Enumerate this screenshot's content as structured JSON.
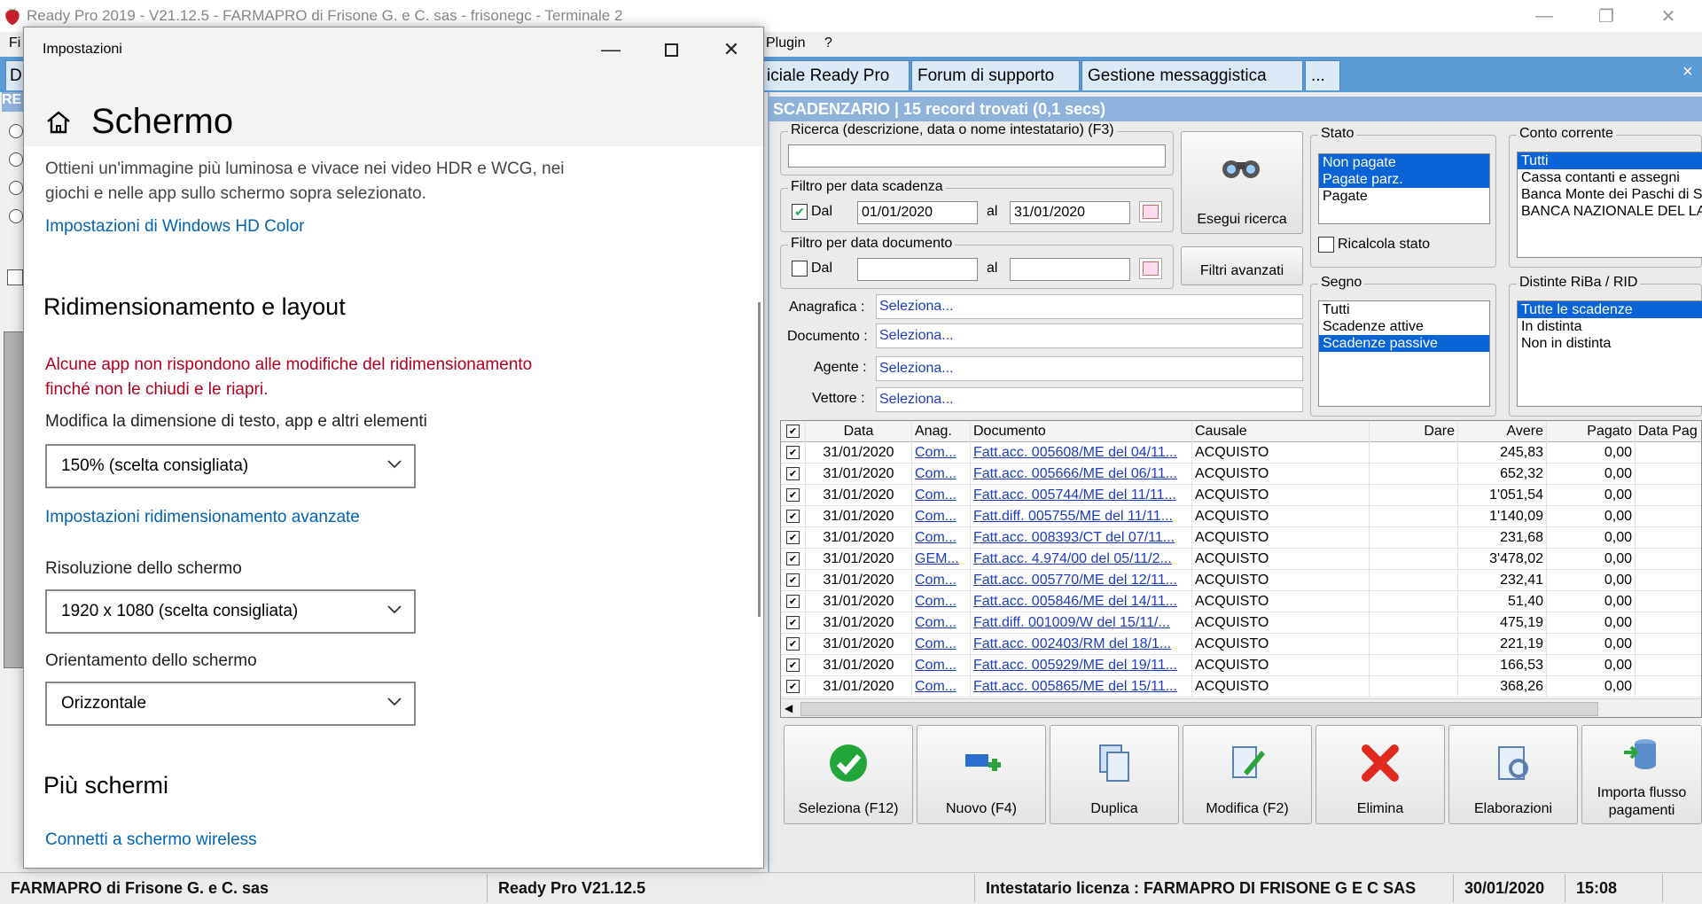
{
  "window": {
    "title": "Ready Pro 2019 - V21.12.5 - FARMAPRO di Frisone G. e C. sas - frisonegc - Terminale 2",
    "min": "—",
    "restore": "❐",
    "close": "✕"
  },
  "menu": {
    "file_partial": "Fi",
    "plugin": "Plugin",
    "help": "?"
  },
  "tabs": [
    "iciale Ready Pro",
    "Forum di supporto",
    "Gestione messaggistica",
    "..."
  ],
  "tab_close": "×",
  "left_sliver": {
    "tab_partial": "D",
    "label_partial": "RE"
  },
  "scadenzario": {
    "header": "SCADENZARIO | 15 record trovati (0,1 secs)",
    "search_label": "Ricerca (descrizione, data o nome intestatario) (F3)",
    "search_value": "",
    "filter_due_label": "Filtro per data scadenza",
    "due_dal_checked": true,
    "dal_label": "Dal",
    "al_label": "al",
    "due_from": "01/01/2020",
    "due_to": "31/01/2020",
    "filter_doc_label": "Filtro per data documento",
    "doc_dal_checked": false,
    "doc_from": "",
    "doc_to": "",
    "search_button": "Esegui ricerca",
    "advanced_button": "Filtri avanzati",
    "anagrafica_label": "Anagrafica :",
    "documento_label": "Documento :",
    "agente_label": "Agente :",
    "vettore_label": "Vettore :",
    "select_placeholder": "Seleziona...",
    "stato": {
      "title": "Stato",
      "items": [
        "Non pagate",
        "Pagate parz.",
        "Pagate"
      ],
      "selected": [
        0,
        1
      ]
    },
    "ricalcola_label": "Ricalcola stato",
    "segno": {
      "title": "Segno",
      "items": [
        "Tutti",
        "Scadenze attive",
        "Scadenze passive"
      ],
      "selected": [
        2
      ]
    },
    "conto": {
      "title": "Conto corrente",
      "items": [
        "Tutti",
        "Cassa contanti e assegni",
        "Banca Monte dei Paschi di Si",
        "BANCA NAZIONALE DEL LAV"
      ],
      "selected": [
        0
      ]
    },
    "distinte": {
      "title": "Distinte RiBa / RID",
      "items": [
        "Tutte le scadenze",
        "In distinta",
        "Non in distinta"
      ],
      "selected": [
        0
      ]
    },
    "columns": [
      "Data",
      "Anag.",
      "Documento",
      "Causale",
      "Dare",
      "Avere",
      "Pagato",
      "Data Pag"
    ],
    "rows": [
      [
        "31/01/2020",
        "Com...",
        "Fatt.acc. 005608/ME del 04/11...",
        "ACQUISTO",
        "",
        "245,83",
        "0,00"
      ],
      [
        "31/01/2020",
        "Com...",
        "Fatt.acc. 005666/ME del 06/11...",
        "ACQUISTO",
        "",
        "652,32",
        "0,00"
      ],
      [
        "31/01/2020",
        "Com...",
        "Fatt.acc. 005744/ME del 11/11...",
        "ACQUISTO",
        "",
        "1'051,54",
        "0,00"
      ],
      [
        "31/01/2020",
        "Com...",
        "Fatt.diff. 005755/ME del 11/11...",
        "ACQUISTO",
        "",
        "1'140,09",
        "0,00"
      ],
      [
        "31/01/2020",
        "Com...",
        "Fatt.acc. 008393/CT del 07/11...",
        "ACQUISTO",
        "",
        "231,68",
        "0,00"
      ],
      [
        "31/01/2020",
        "GEM...",
        "Fatt.acc. 4.974/00 del 05/11/2...",
        "ACQUISTO",
        "",
        "3'478,02",
        "0,00"
      ],
      [
        "31/01/2020",
        "Com...",
        "Fatt.acc. 005770/ME del 12/11...",
        "ACQUISTO",
        "",
        "232,41",
        "0,00"
      ],
      [
        "31/01/2020",
        "Com...",
        "Fatt.acc. 005846/ME del 14/11...",
        "ACQUISTO",
        "",
        "51,40",
        "0,00"
      ],
      [
        "31/01/2020",
        "Com...",
        "Fatt.diff. 001009/W del 15/11/...",
        "ACQUISTO",
        "",
        "475,19",
        "0,00"
      ],
      [
        "31/01/2020",
        "Com...",
        "Fatt.acc. 002403/RM del 18/1...",
        "ACQUISTO",
        "",
        "221,19",
        "0,00"
      ],
      [
        "31/01/2020",
        "Com...",
        "Fatt.acc. 005929/ME del 19/11...",
        "ACQUISTO",
        "",
        "166,53",
        "0,00"
      ],
      [
        "31/01/2020",
        "Com...",
        "Fatt.acc. 005865/ME del 15/11...",
        "ACQUISTO",
        "",
        "368,26",
        "0,00"
      ]
    ],
    "actions": [
      {
        "label": "Seleziona (F12)",
        "icon": "checkmark-icon"
      },
      {
        "label": "Nuovo (F4)",
        "icon": "new-record-icon"
      },
      {
        "label": "Duplica",
        "icon": "duplicate-icon"
      },
      {
        "label": "Modifica (F2)",
        "icon": "edit-icon"
      },
      {
        "label": "Elimina",
        "icon": "delete-icon"
      },
      {
        "label": "Elaborazioni",
        "icon": "processing-icon"
      },
      {
        "label": "Importa flusso pagamenti",
        "icon": "import-icon"
      }
    ]
  },
  "statusbar": {
    "company": "FARMAPRO di Frisone G. e C. sas",
    "version": "Ready Pro V21.12.5",
    "license": "Intestatario licenza : FARMAPRO DI FRISONE G E C SAS",
    "date": "30/01/2020",
    "time": "15:08"
  },
  "settings": {
    "window_title": "Impostazioni",
    "heading": "Schermo",
    "hdr_text_1": "Ottieni un'immagine più luminosa e vivace nei video HDR e WCG, nei",
    "hdr_text_2": "giochi e nelle app sullo schermo sopra selezionato.",
    "hdr_link": "Impostazioni di Windows HD Color",
    "scale_section": "Ridimensionamento e layout",
    "warning_1": "Alcune app non rispondono alle modifiche del ridimensionamento",
    "warning_2": "finché non le chiudi e le riapri.",
    "scale_label": "Modifica la dimensione di testo, app e altri elementi",
    "scale_value": "150% (scelta consigliata)",
    "advanced_scale_link": "Impostazioni ridimensionamento avanzate",
    "resolution_label": "Risoluzione dello schermo",
    "resolution_value": "1920 x 1080 (scelta consigliata)",
    "orientation_label": "Orientamento dello schermo",
    "orientation_value": "Orizzontale",
    "multi_section": "Più schermi",
    "wireless_link": "Connetti a schermo wireless"
  },
  "colors": {
    "tab_bar": "#5b9bd5",
    "header": "#8fb2dd",
    "selection": "#0a64d6",
    "link": "#0063b1",
    "warning": "#b00020"
  }
}
